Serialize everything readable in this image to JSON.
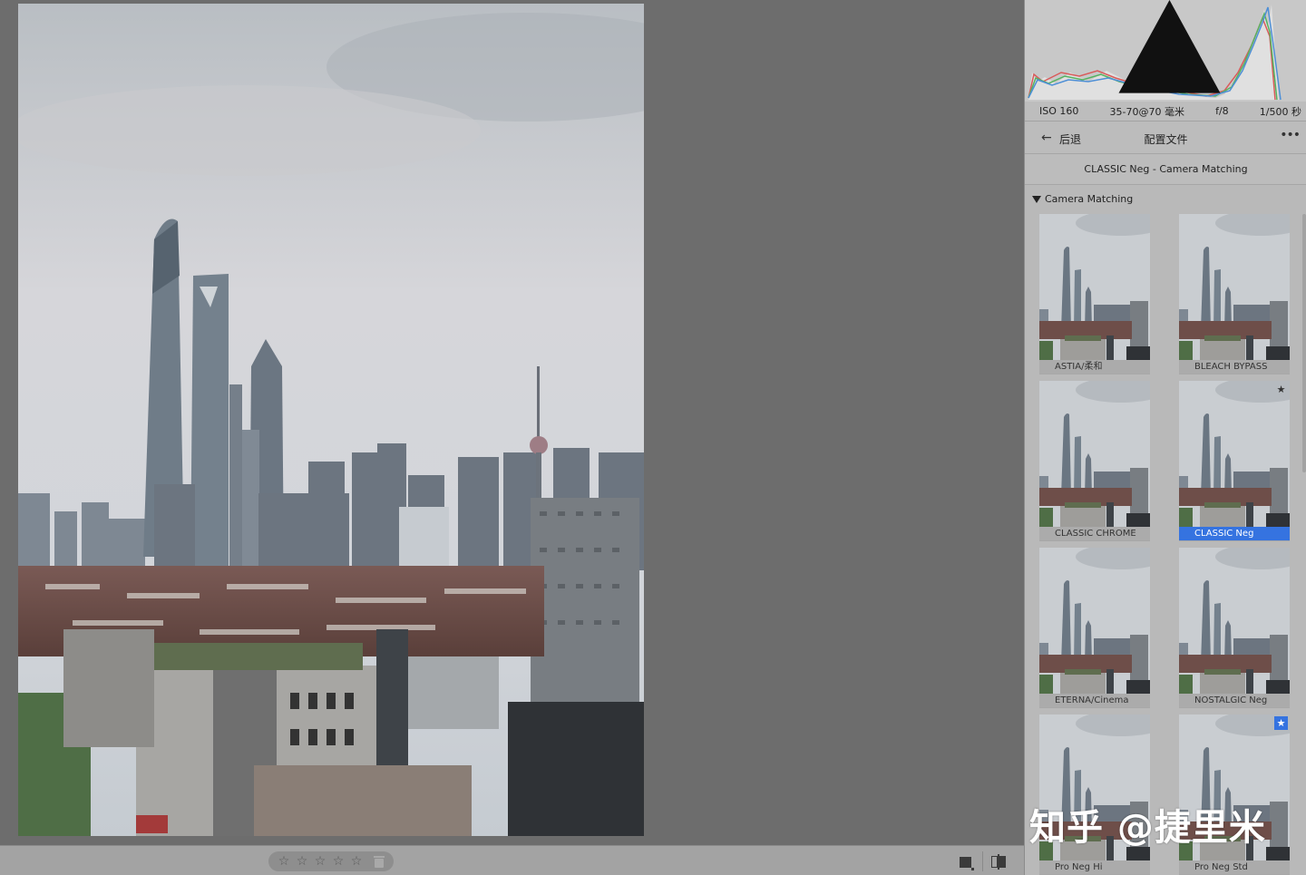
{
  "histogram": {
    "clip_icon": "shadow-clipping-icon"
  },
  "exif": {
    "iso": "ISO 160",
    "lens": "35-70@70 毫米",
    "aperture": "f/8",
    "shutter": "1/500 秒"
  },
  "profile_browser": {
    "back_label": "后退",
    "title": "配置文件",
    "more_icon": "more-icon",
    "current_profile": "CLASSIC Neg - Camera Matching",
    "group_name": "Camera Matching",
    "profiles": [
      {
        "name": "ASTIA/柔和",
        "selected": false,
        "favorite": false
      },
      {
        "name": "BLEACH BYPASS",
        "selected": false,
        "favorite": false
      },
      {
        "name": "CLASSIC CHROME",
        "selected": false,
        "favorite": false
      },
      {
        "name": "CLASSIC Neg",
        "selected": true,
        "favorite": true
      },
      {
        "name": "ETERNA/Cinema",
        "selected": false,
        "favorite": false
      },
      {
        "name": "NOSTALGIC Neg",
        "selected": false,
        "favorite": false
      },
      {
        "name": "Pro Neg Hi",
        "selected": false,
        "favorite": false
      },
      {
        "name": "Pro Neg Std",
        "selected": false,
        "favorite": true
      }
    ]
  },
  "toolbar": {
    "stars": [
      "☆",
      "☆",
      "☆",
      "☆",
      "☆"
    ],
    "rating": 0
  },
  "watermark": "知乎 @捷里米",
  "colors": {
    "selection": "#3573e0",
    "panel_bg": "#b9b9b9",
    "viewer_bg": "#6d6d6d"
  }
}
